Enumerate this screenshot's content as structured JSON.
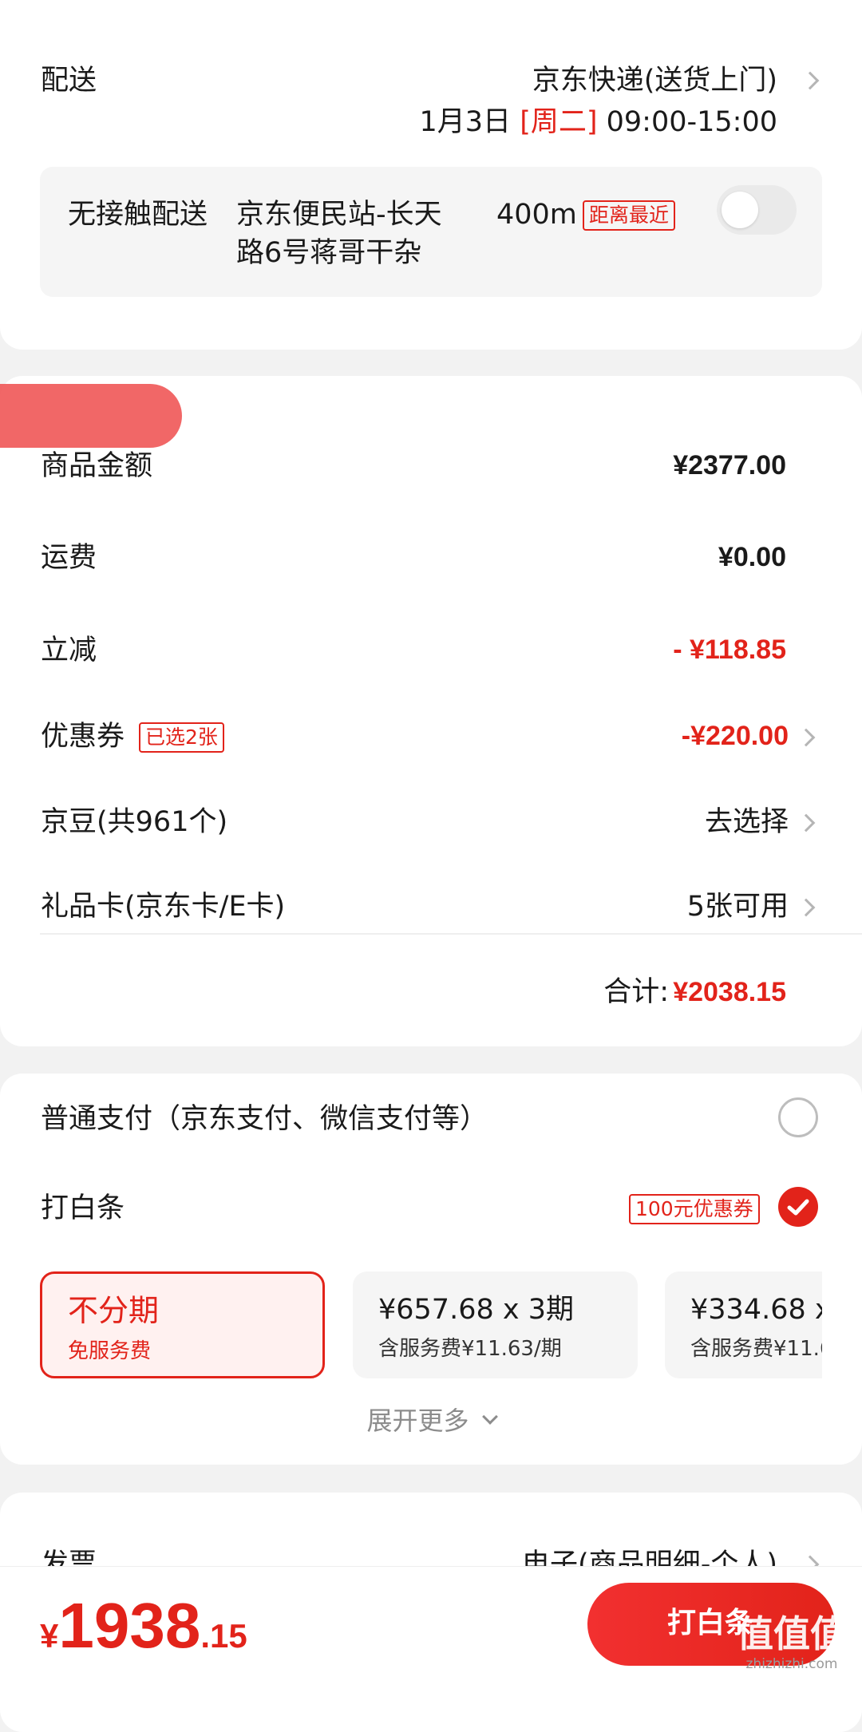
{
  "delivery": {
    "label": "配送",
    "method": "京东快递(送货上门)",
    "date": "1月3日",
    "weekday": "[周二]",
    "time": "09:00-15:00",
    "contactless_label": "无接触配送",
    "station_line1": "京东便民站-长天",
    "station_line2": "路6号蒋哥干杂",
    "distance": "400m",
    "nearest_tag": "距离最近"
  },
  "summary": {
    "goods_label": "商品金额",
    "goods_value": "¥2377.00",
    "shipping_label": "运费",
    "shipping_value": "¥0.00",
    "discount_label": "立减",
    "discount_value": "- ¥118.85",
    "coupon_label": "优惠券",
    "coupon_tag": "已选2张",
    "coupon_value": "-¥220.00",
    "jd_beans_label": "京豆(共961个)",
    "jd_beans_action": "去选择",
    "gift_card_label": "礼品卡(京东卡/E卡)",
    "gift_card_value": "5张可用",
    "total_label": "合计:",
    "total_value": "¥2038.15"
  },
  "payment": {
    "normal_label": "普通支付（京东支付、微信支付等）",
    "baitiao_label": "打白条",
    "baitiao_tag": "100元优惠券",
    "plans": [
      {
        "title": "不分期",
        "subtitle": "免服务费"
      },
      {
        "title": "¥657.68 x 3期",
        "subtitle": "含服务费¥11.63/期"
      },
      {
        "title": "¥334.68 x",
        "subtitle": "含服务费¥11.6"
      }
    ],
    "expand_label": "展开更多"
  },
  "invoice": {
    "label": "发票",
    "value": "电子(商品明细-个人)"
  },
  "footer": {
    "currency": "¥",
    "price_int": "1938",
    "price_dec": ".15",
    "submit_label": "打白条"
  },
  "watermark": {
    "brand": "值值值",
    "url": "zhizhizhi.com"
  },
  "colors": {
    "accent": "#e2231a",
    "background": "#f2f2f2"
  }
}
